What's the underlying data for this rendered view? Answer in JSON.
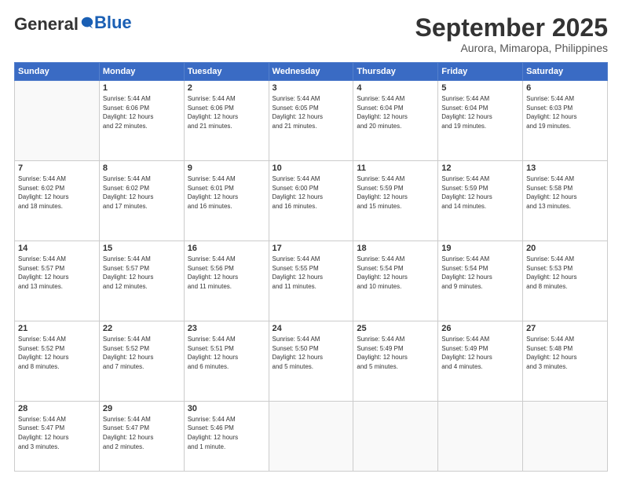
{
  "logo": {
    "general": "General",
    "blue": "Blue"
  },
  "header": {
    "month": "September 2025",
    "location": "Aurora, Mimaropa, Philippines"
  },
  "weekdays": [
    "Sunday",
    "Monday",
    "Tuesday",
    "Wednesday",
    "Thursday",
    "Friday",
    "Saturday"
  ],
  "weeks": [
    [
      {
        "num": "",
        "info": ""
      },
      {
        "num": "1",
        "info": "Sunrise: 5:44 AM\nSunset: 6:06 PM\nDaylight: 12 hours\nand 22 minutes."
      },
      {
        "num": "2",
        "info": "Sunrise: 5:44 AM\nSunset: 6:06 PM\nDaylight: 12 hours\nand 21 minutes."
      },
      {
        "num": "3",
        "info": "Sunrise: 5:44 AM\nSunset: 6:05 PM\nDaylight: 12 hours\nand 21 minutes."
      },
      {
        "num": "4",
        "info": "Sunrise: 5:44 AM\nSunset: 6:04 PM\nDaylight: 12 hours\nand 20 minutes."
      },
      {
        "num": "5",
        "info": "Sunrise: 5:44 AM\nSunset: 6:04 PM\nDaylight: 12 hours\nand 19 minutes."
      },
      {
        "num": "6",
        "info": "Sunrise: 5:44 AM\nSunset: 6:03 PM\nDaylight: 12 hours\nand 19 minutes."
      }
    ],
    [
      {
        "num": "7",
        "info": "Sunrise: 5:44 AM\nSunset: 6:02 PM\nDaylight: 12 hours\nand 18 minutes."
      },
      {
        "num": "8",
        "info": "Sunrise: 5:44 AM\nSunset: 6:02 PM\nDaylight: 12 hours\nand 17 minutes."
      },
      {
        "num": "9",
        "info": "Sunrise: 5:44 AM\nSunset: 6:01 PM\nDaylight: 12 hours\nand 16 minutes."
      },
      {
        "num": "10",
        "info": "Sunrise: 5:44 AM\nSunset: 6:00 PM\nDaylight: 12 hours\nand 16 minutes."
      },
      {
        "num": "11",
        "info": "Sunrise: 5:44 AM\nSunset: 5:59 PM\nDaylight: 12 hours\nand 15 minutes."
      },
      {
        "num": "12",
        "info": "Sunrise: 5:44 AM\nSunset: 5:59 PM\nDaylight: 12 hours\nand 14 minutes."
      },
      {
        "num": "13",
        "info": "Sunrise: 5:44 AM\nSunset: 5:58 PM\nDaylight: 12 hours\nand 13 minutes."
      }
    ],
    [
      {
        "num": "14",
        "info": "Sunrise: 5:44 AM\nSunset: 5:57 PM\nDaylight: 12 hours\nand 13 minutes."
      },
      {
        "num": "15",
        "info": "Sunrise: 5:44 AM\nSunset: 5:57 PM\nDaylight: 12 hours\nand 12 minutes."
      },
      {
        "num": "16",
        "info": "Sunrise: 5:44 AM\nSunset: 5:56 PM\nDaylight: 12 hours\nand 11 minutes."
      },
      {
        "num": "17",
        "info": "Sunrise: 5:44 AM\nSunset: 5:55 PM\nDaylight: 12 hours\nand 11 minutes."
      },
      {
        "num": "18",
        "info": "Sunrise: 5:44 AM\nSunset: 5:54 PM\nDaylight: 12 hours\nand 10 minutes."
      },
      {
        "num": "19",
        "info": "Sunrise: 5:44 AM\nSunset: 5:54 PM\nDaylight: 12 hours\nand 9 minutes."
      },
      {
        "num": "20",
        "info": "Sunrise: 5:44 AM\nSunset: 5:53 PM\nDaylight: 12 hours\nand 8 minutes."
      }
    ],
    [
      {
        "num": "21",
        "info": "Sunrise: 5:44 AM\nSunset: 5:52 PM\nDaylight: 12 hours\nand 8 minutes."
      },
      {
        "num": "22",
        "info": "Sunrise: 5:44 AM\nSunset: 5:52 PM\nDaylight: 12 hours\nand 7 minutes."
      },
      {
        "num": "23",
        "info": "Sunrise: 5:44 AM\nSunset: 5:51 PM\nDaylight: 12 hours\nand 6 minutes."
      },
      {
        "num": "24",
        "info": "Sunrise: 5:44 AM\nSunset: 5:50 PM\nDaylight: 12 hours\nand 5 minutes."
      },
      {
        "num": "25",
        "info": "Sunrise: 5:44 AM\nSunset: 5:49 PM\nDaylight: 12 hours\nand 5 minutes."
      },
      {
        "num": "26",
        "info": "Sunrise: 5:44 AM\nSunset: 5:49 PM\nDaylight: 12 hours\nand 4 minutes."
      },
      {
        "num": "27",
        "info": "Sunrise: 5:44 AM\nSunset: 5:48 PM\nDaylight: 12 hours\nand 3 minutes."
      }
    ],
    [
      {
        "num": "28",
        "info": "Sunrise: 5:44 AM\nSunset: 5:47 PM\nDaylight: 12 hours\nand 3 minutes."
      },
      {
        "num": "29",
        "info": "Sunrise: 5:44 AM\nSunset: 5:47 PM\nDaylight: 12 hours\nand 2 minutes."
      },
      {
        "num": "30",
        "info": "Sunrise: 5:44 AM\nSunset: 5:46 PM\nDaylight: 12 hours\nand 1 minute."
      },
      {
        "num": "",
        "info": ""
      },
      {
        "num": "",
        "info": ""
      },
      {
        "num": "",
        "info": ""
      },
      {
        "num": "",
        "info": ""
      }
    ]
  ]
}
